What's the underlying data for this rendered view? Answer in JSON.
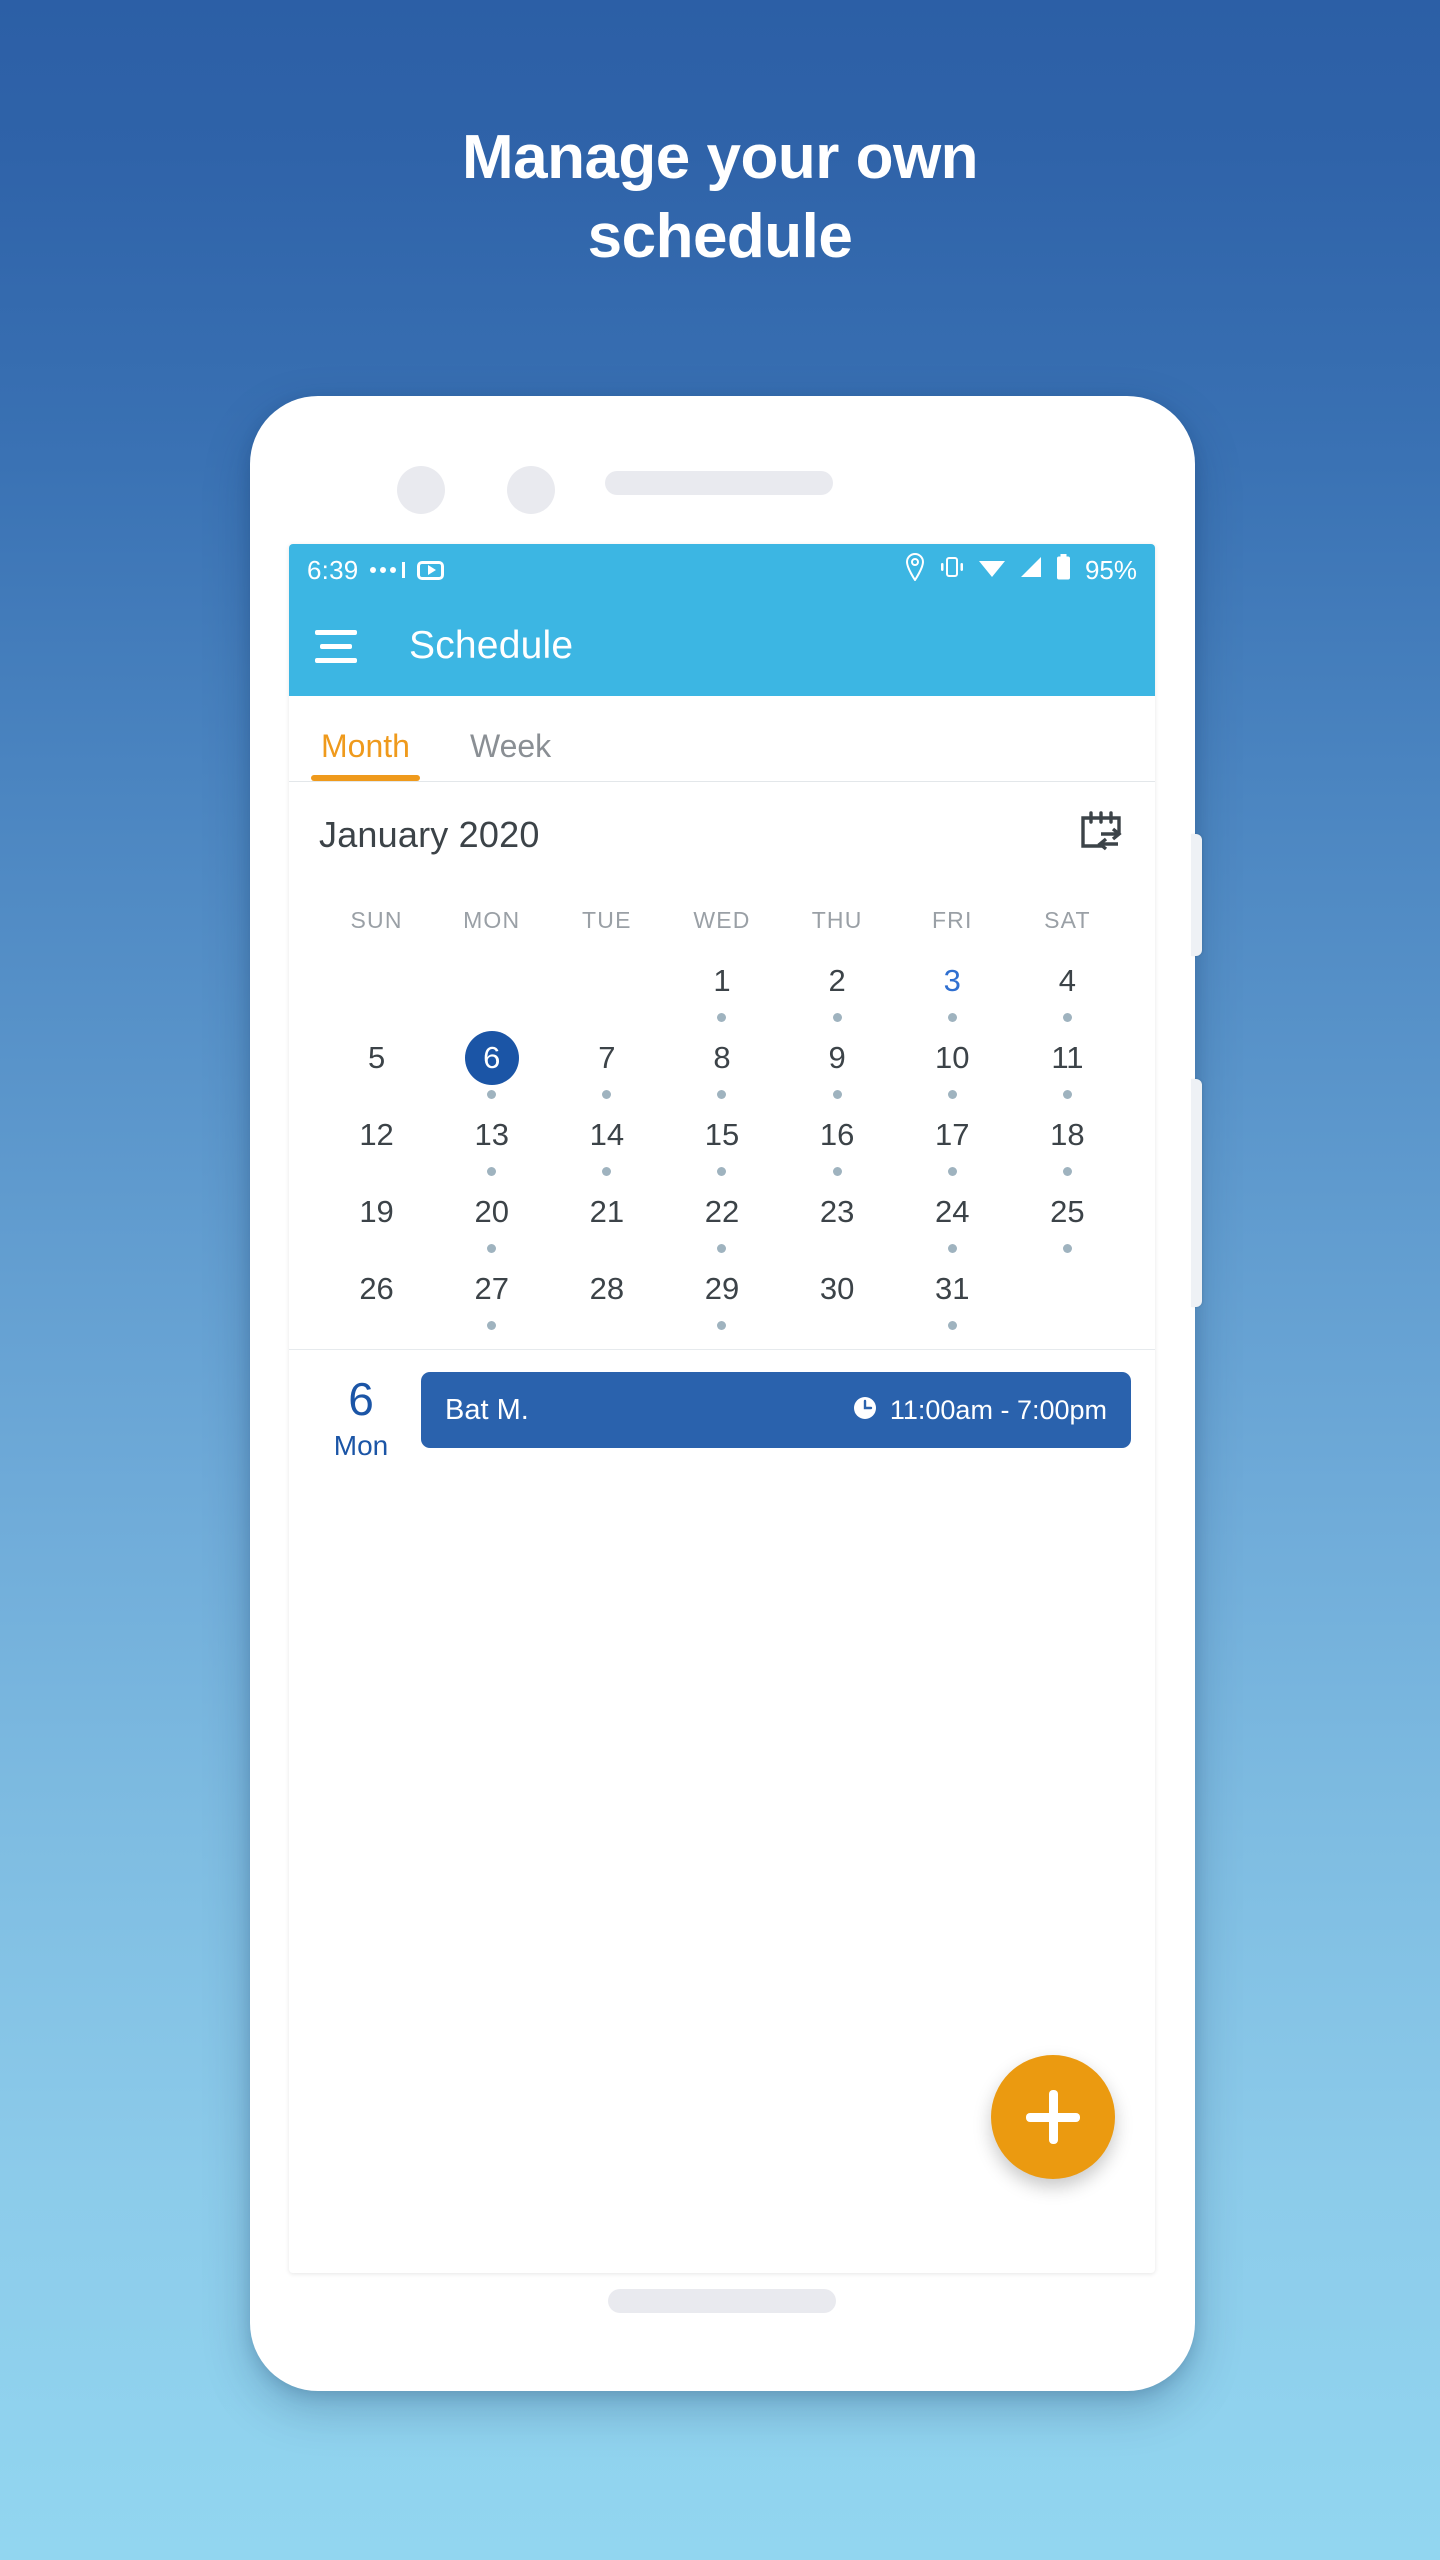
{
  "headline": "Manage your own\nschedule",
  "phone": {
    "status_bar": {
      "clock": "6:39",
      "icons_left": [
        "more-dots-icon",
        "youtube-play-icon"
      ],
      "icons_right": [
        "location-pin-icon",
        "vibrate-icon",
        "wifi-icon",
        "signal-icon",
        "battery-icon"
      ],
      "battery_percent": "95%",
      "background_color": "#3cb6e3"
    },
    "app_bar": {
      "menu_icon": "hamburger-menu-icon",
      "title": "Schedule",
      "background_color": "#3cb6e3"
    },
    "tabs": [
      {
        "label": "Month",
        "active": true
      },
      {
        "label": "Week",
        "active": false
      }
    ],
    "tab_accent_color": "#ef9a1c",
    "calendar": {
      "month_label": "January 2020",
      "sync_icon": "calendar-swap-icon",
      "weekdays": [
        "SUN",
        "MON",
        "TUE",
        "WED",
        "THU",
        "FRI",
        "SAT"
      ],
      "selected_day": 6,
      "today": 3,
      "selected_color": "#1b55a6",
      "today_color": "#2f6fd0",
      "dot_color": "#9fb3bf",
      "weeks": [
        [
          {
            "day": "",
            "dot": false
          },
          {
            "day": "",
            "dot": false
          },
          {
            "day": "",
            "dot": false
          },
          {
            "day": "1",
            "dot": true
          },
          {
            "day": "2",
            "dot": true
          },
          {
            "day": "3",
            "dot": true,
            "today": true
          },
          {
            "day": "4",
            "dot": true
          }
        ],
        [
          {
            "day": "5",
            "dot": false
          },
          {
            "day": "6",
            "dot": true,
            "selected": true
          },
          {
            "day": "7",
            "dot": true
          },
          {
            "day": "8",
            "dot": true
          },
          {
            "day": "9",
            "dot": true
          },
          {
            "day": "10",
            "dot": true
          },
          {
            "day": "11",
            "dot": true
          }
        ],
        [
          {
            "day": "12",
            "dot": false
          },
          {
            "day": "13",
            "dot": true
          },
          {
            "day": "14",
            "dot": true
          },
          {
            "day": "15",
            "dot": true
          },
          {
            "day": "16",
            "dot": true
          },
          {
            "day": "17",
            "dot": true
          },
          {
            "day": "18",
            "dot": true
          }
        ],
        [
          {
            "day": "19",
            "dot": false
          },
          {
            "day": "20",
            "dot": true
          },
          {
            "day": "21",
            "dot": false
          },
          {
            "day": "22",
            "dot": true
          },
          {
            "day": "23",
            "dot": false
          },
          {
            "day": "24",
            "dot": true
          },
          {
            "day": "25",
            "dot": true
          }
        ],
        [
          {
            "day": "26",
            "dot": false
          },
          {
            "day": "27",
            "dot": true
          },
          {
            "day": "28",
            "dot": false
          },
          {
            "day": "29",
            "dot": true
          },
          {
            "day": "30",
            "dot": false
          },
          {
            "day": "31",
            "dot": true
          },
          {
            "day": "",
            "dot": false
          }
        ]
      ]
    },
    "events": [
      {
        "day_number": "6",
        "weekday": "Mon",
        "title": "Bat M.",
        "time": "11:00am - 7:00pm",
        "clock_icon": "clock-icon",
        "card_color": "#2a62ad"
      }
    ],
    "fab": {
      "icon": "plus-icon",
      "color": "#eb9a10"
    }
  },
  "colors": {
    "background_top": "#2c5fa6",
    "background_bottom": "#92d6f0",
    "accent_orange": "#ef9a1c",
    "primary_blue": "#1b55a6",
    "app_bar_blue": "#3cb6e3"
  }
}
